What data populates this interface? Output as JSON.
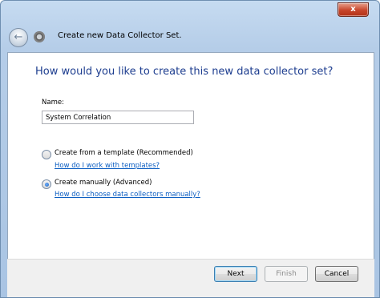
{
  "window": {
    "title": "Create new Data Collector Set.",
    "close_glyph": "x"
  },
  "wizard": {
    "question": "How would you like to create this new data collector set?",
    "name_label": "Name:",
    "name_value": "System Correlation",
    "options": [
      {
        "label": "Create from a template (Recommended)",
        "selected": false,
        "help_link": "How do I work with templates?"
      },
      {
        "label": "Create manually (Advanced)",
        "selected": true,
        "help_link": "How do I choose data collectors manually?"
      }
    ]
  },
  "buttons": {
    "next": "Next",
    "finish": "Finish",
    "cancel": "Cancel"
  },
  "icons": {
    "back": "back-arrow-icon",
    "app": "performance-monitor-icon"
  }
}
